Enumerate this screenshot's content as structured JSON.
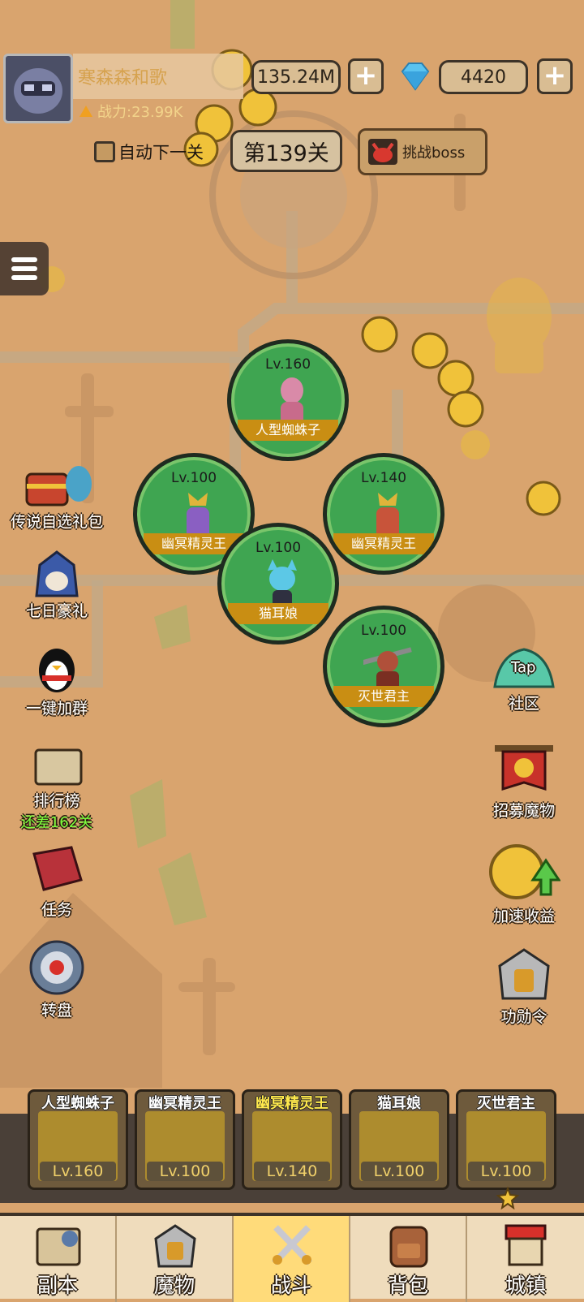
{
  "player": {
    "name": "寒森森和歌",
    "power": "战力:23.99K",
    "gold": "135.24M",
    "gems": "4420"
  },
  "stage": {
    "auto_label": "自动下一关",
    "level_label": "第139关",
    "boss_label": "挑战boss"
  },
  "units": [
    {
      "name": "人型蜘蛛子",
      "level": "Lv.160"
    },
    {
      "name": "幽冥精灵王",
      "level": "Lv.100"
    },
    {
      "name": "幽冥精灵王",
      "level": "Lv.140"
    },
    {
      "name": "猫耳娘",
      "level": "Lv.100"
    },
    {
      "name": "灭世君主",
      "level": "Lv.100"
    }
  ],
  "left_buttons": [
    {
      "label": "传说自选礼包",
      "icon": "treasure-chest-icon"
    },
    {
      "label": "七日豪礼",
      "icon": "knight-helmet-icon"
    },
    {
      "label": "一键加群",
      "icon": "penguin-icon"
    },
    {
      "label": "排行榜",
      "sub": "还差162关",
      "icon": "scroll-icon"
    },
    {
      "label": "任务",
      "icon": "book-icon"
    },
    {
      "label": "转盘",
      "icon": "wheel-icon"
    }
  ],
  "right_buttons": [
    {
      "label": "社区",
      "icon": "tap-mountain-icon",
      "badge": "Tap"
    },
    {
      "label": "招募魔物",
      "icon": "banner-icon"
    },
    {
      "label": "加速收益",
      "icon": "coin-arrow-icon"
    },
    {
      "label": "功勋令",
      "icon": "helmet-icon"
    }
  ],
  "team": [
    {
      "name": "人型蜘蛛子",
      "level": "Lv.160",
      "highlight": false
    },
    {
      "name": "幽冥精灵王",
      "level": "Lv.100",
      "highlight": false
    },
    {
      "name": "幽冥精灵王",
      "level": "Lv.140",
      "highlight": true
    },
    {
      "name": "猫耳娘",
      "level": "Lv.100",
      "highlight": false
    },
    {
      "name": "灭世君主",
      "level": "Lv.100",
      "highlight": false
    }
  ],
  "nav": [
    {
      "label": "副本",
      "icon": "map-icon",
      "active": false
    },
    {
      "label": "魔物",
      "icon": "monster-icon",
      "active": false
    },
    {
      "label": "战斗",
      "icon": "swords-icon",
      "active": true
    },
    {
      "label": "背包",
      "icon": "backpack-icon",
      "active": false
    },
    {
      "label": "城镇",
      "icon": "shop-icon",
      "active": false
    }
  ],
  "colors": {
    "background": "#d9a46e",
    "unit_circle": "#3fa551",
    "ribbon": "#c98e13",
    "nav_active": "#ffdb7a",
    "rank_sub": "#7dff3d"
  }
}
